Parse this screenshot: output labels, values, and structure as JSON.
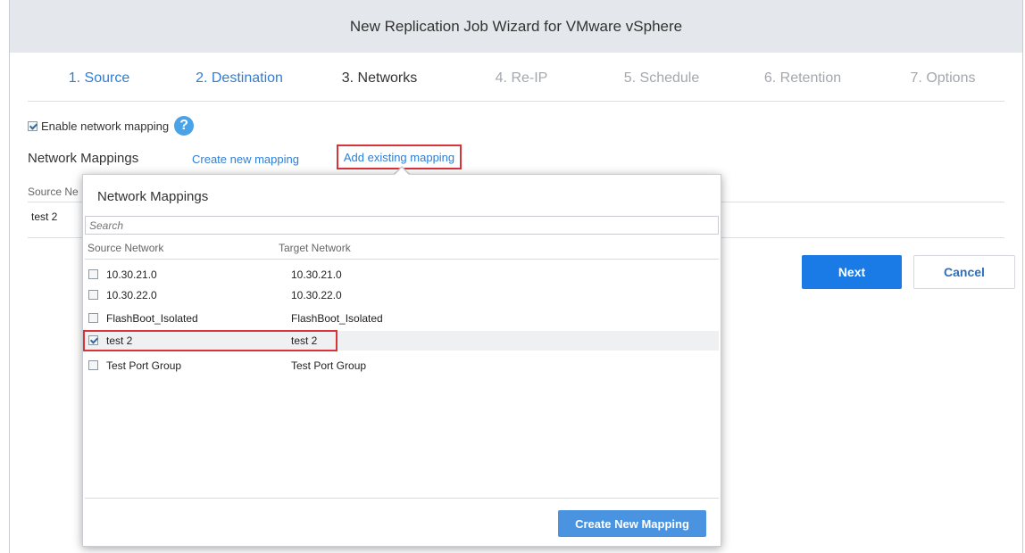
{
  "window": {
    "title": "New Replication Job Wizard for VMware vSphere"
  },
  "steps": [
    {
      "label": "1. Source",
      "state": "done"
    },
    {
      "label": "2. Destination",
      "state": "done"
    },
    {
      "label": "3. Networks",
      "state": "current"
    },
    {
      "label": "4. Re-IP",
      "state": "future"
    },
    {
      "label": "5. Schedule",
      "state": "future"
    },
    {
      "label": "6. Retention",
      "state": "future"
    },
    {
      "label": "7. Options",
      "state": "future"
    }
  ],
  "networks": {
    "enable_label": "Enable network mapping",
    "enable_checked": true,
    "help_icon": "question-icon",
    "mappings_label": "Network Mappings",
    "create_link": "Create new mapping",
    "add_link": "Add existing mapping",
    "table_header_source": "Source Ne",
    "rows": [
      {
        "source": "test 2"
      }
    ]
  },
  "buttons": {
    "next": "Next",
    "cancel": "Cancel"
  },
  "popup": {
    "title": "Network Mappings",
    "search_placeholder": "Search",
    "col_source": "Source Network",
    "col_target": "Target Network",
    "rows": [
      {
        "source": "10.30.21.0",
        "target": "10.30.21.0",
        "checked": false
      },
      {
        "source": "10.30.22.0",
        "target": "10.30.22.0",
        "checked": false
      },
      {
        "source": "FlashBoot_Isolated",
        "target": "FlashBoot_Isolated",
        "checked": false
      },
      {
        "source": "test 2",
        "target": "test 2",
        "checked": true
      },
      {
        "source": "Test Port Group",
        "target": "Test Port Group",
        "checked": false
      }
    ],
    "create_button": "Create New Mapping"
  },
  "colors": {
    "accent": "#1a7ae6",
    "link": "#2f7fd6",
    "highlight": "#d9333a"
  }
}
